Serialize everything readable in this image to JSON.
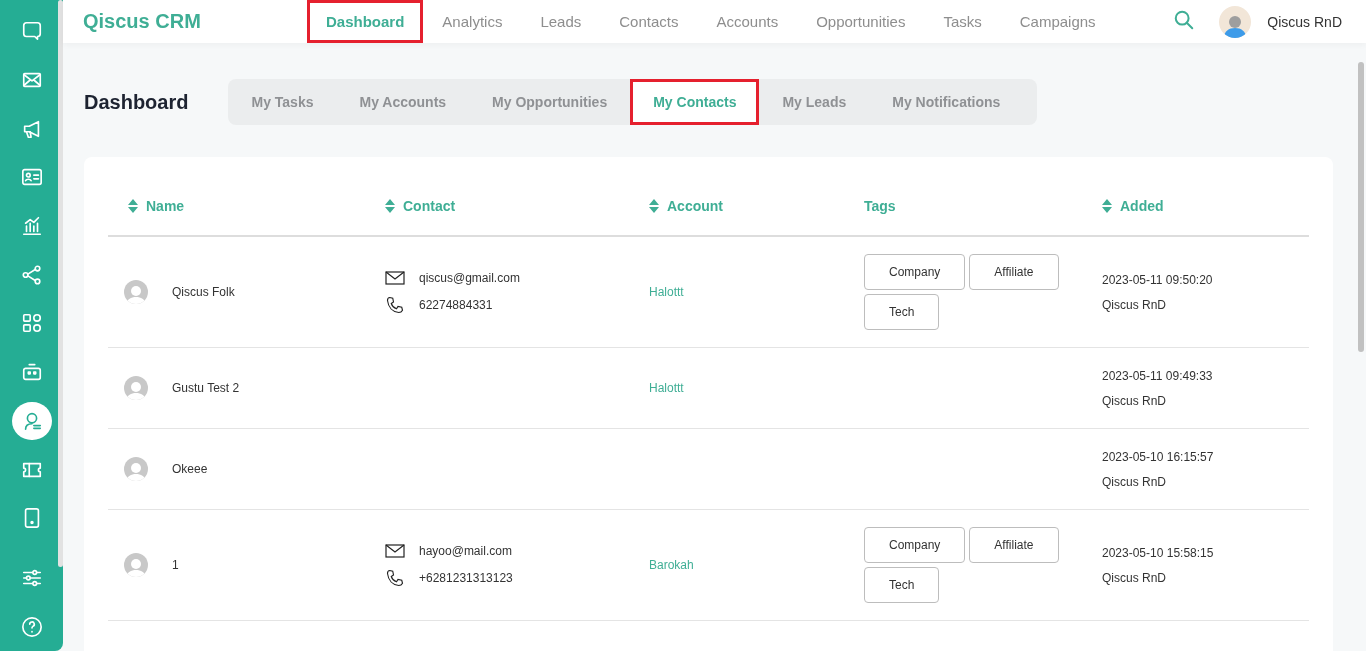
{
  "sidebar": {
    "items": [
      {
        "selected": false
      },
      {
        "selected": false
      },
      {
        "selected": false
      },
      {
        "selected": false
      },
      {
        "selected": false
      },
      {
        "selected": false
      },
      {
        "selected": false
      },
      {
        "selected": false
      },
      {
        "selected": true
      },
      {
        "selected": false
      },
      {
        "selected": false
      },
      {
        "selected": false
      },
      {
        "selected": false
      }
    ]
  },
  "header": {
    "brand": "Qiscus CRM",
    "nav": [
      {
        "label": "Dashboard",
        "selected": true,
        "highlighted": true
      },
      {
        "label": "Analytics",
        "selected": false,
        "highlighted": false
      },
      {
        "label": "Leads",
        "selected": false,
        "highlighted": false
      },
      {
        "label": "Contacts",
        "selected": false,
        "highlighted": false
      },
      {
        "label": "Accounts",
        "selected": false,
        "highlighted": false
      },
      {
        "label": "Opportunities",
        "selected": false,
        "highlighted": false
      },
      {
        "label": "Tasks",
        "selected": false,
        "highlighted": false
      },
      {
        "label": "Campaigns",
        "selected": false,
        "highlighted": false
      }
    ],
    "user": "Qiscus RnD"
  },
  "page": {
    "title": "Dashboard",
    "tabs": [
      {
        "label": "My Tasks",
        "selected": false,
        "highlighted": false
      },
      {
        "label": "My Accounts",
        "selected": false,
        "highlighted": false
      },
      {
        "label": "My Opportunities",
        "selected": false,
        "highlighted": false
      },
      {
        "label": "My Contacts",
        "selected": true,
        "highlighted": true
      },
      {
        "label": "My Leads",
        "selected": false,
        "highlighted": false
      },
      {
        "label": "My Notifications",
        "selected": false,
        "highlighted": false
      }
    ]
  },
  "table": {
    "columns": [
      {
        "label": "Name",
        "sortable": true
      },
      {
        "label": "Contact",
        "sortable": true
      },
      {
        "label": "Account",
        "sortable": true
      },
      {
        "label": "Tags",
        "sortable": false
      },
      {
        "label": "Added",
        "sortable": true
      }
    ],
    "rows": [
      {
        "name": "Qiscus Folk",
        "email": "qiscus@gmail.com",
        "phone": "62274884331",
        "account": "Halottt",
        "tags": [
          "Company",
          "Affiliate",
          "Tech"
        ],
        "added": "2023-05-11 09:50:20",
        "added_by": "Qiscus RnD"
      },
      {
        "name": "Gustu Test 2",
        "account": "Halottt",
        "tags": [],
        "added": "2023-05-11 09:49:33",
        "added_by": "Qiscus RnD"
      },
      {
        "name": "Okeee",
        "tags": [],
        "added": "2023-05-10 16:15:57",
        "added_by": "Qiscus RnD"
      },
      {
        "name": "1",
        "email": "hayoo@mail.com",
        "phone": "+6281231313123",
        "account": "Barokah",
        "tags": [
          "Company",
          "Affiliate",
          "Tech"
        ],
        "added": "2023-05-10 15:58:15",
        "added_by": "Qiscus RnD"
      }
    ]
  }
}
